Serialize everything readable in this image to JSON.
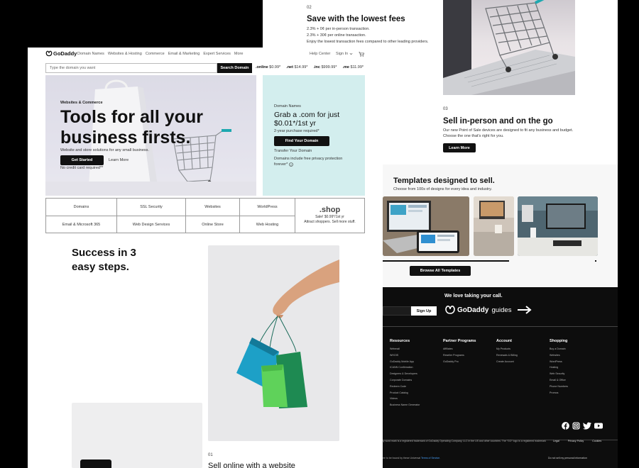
{
  "brand": {
    "name": "GoDaddy"
  },
  "nav": {
    "items": [
      "Domain Names",
      "Websites & Hosting",
      "Commerce",
      "Email & Marketing",
      "Expert Services",
      "More"
    ],
    "help": "Help Center",
    "sign_in": "Sign In"
  },
  "search": {
    "placeholder": "Type the domain you want",
    "button": "Search Domain",
    "tlds": [
      {
        "tld": ".online",
        "price": "$0.99*"
      },
      {
        "tld": ".net",
        "price": "$14.99*"
      },
      {
        "tld": ".inc",
        "price": "$999.99*"
      },
      {
        "tld": ".me",
        "price": "$11.99*"
      }
    ]
  },
  "hero": {
    "eyebrow": "Websites & Commerce",
    "title_line1": "Tools for all your",
    "title_line2": "business firsts.",
    "subtitle": "Website and store solutions for any small business.",
    "cta": "Get Started",
    "learn": "Learn More",
    "note": "No credit card required**"
  },
  "promo": {
    "eyebrow": "Domain Names",
    "title_line1": "Grab a .com for just",
    "title_line2": "$0.01*/1st yr",
    "note": "2-year purchase required*",
    "cta": "Find Your Domain",
    "transfer": "Transfer Your Domain",
    "privacy_line1": "Domains include free privacy protection",
    "privacy_line2": "forever*"
  },
  "categories": {
    "row1": [
      "Domains",
      "SSL Security",
      "Websites",
      "WorldPress"
    ],
    "row2": [
      "Email & Microsoft 365",
      "Web Design Services",
      "Online Store",
      "Web Hosting"
    ],
    "shop": {
      "tld": ".shop",
      "line1": "Sale! $0.99*/1st yr",
      "line2": "Attract shoppers. Sell more stuff."
    }
  },
  "steps_section": {
    "title_line1": "Success in 3",
    "title_line2": "easy steps.",
    "step1_num": "01",
    "step1_title": "Sell online with a website"
  },
  "step2": {
    "num": "02",
    "title": "Save with the lowest fees",
    "lines": [
      "2.3% + 0¢ per in-person transaction.",
      "2.3% + 30¢ per online transaction.",
      "Enjoy the lowest transaction fees compared to other leading providers."
    ]
  },
  "step3": {
    "num": "03",
    "title": "Sell in-person and on the go",
    "line1": "Our new Point of Sale devices are designed to fit any business and budget.",
    "line2": "Choose the one that's right for you.",
    "cta": "Learn More"
  },
  "templates": {
    "title": "Templates designed to sell.",
    "subtitle": "Choose from 100s of designs for every idea and industry.",
    "cta": "Browse All Templates"
  },
  "footer": {
    "call": "We love taking your call.",
    "signup": "Sign Up",
    "guides_brand": "GoDaddy",
    "guides": "guides",
    "columns": [
      {
        "title": "Resources",
        "links": [
          "Webmail",
          "WHOIS",
          "GoDaddy Mobile App",
          "ICANN Confirmation",
          "Designers & Developers",
          "Corporate Domains",
          "Redeem Code",
          "Product Catalog",
          "Videos",
          "Business Name Generator"
        ]
      },
      {
        "title": "Partner Programs",
        "links": [
          "Affiliates",
          "Reseller Programs",
          "GoDaddy Pro"
        ]
      },
      {
        "title": "Account",
        "links": [
          "My Products",
          "Renewals & Billing",
          "Create Account"
        ]
      },
      {
        "title": "Shopping",
        "links": [
          "Buy a Domain",
          "Websites",
          "WordPress",
          "Hosting",
          "Web Security",
          "Email & Office",
          "Phone Numbers",
          "Promos"
        ]
      }
    ],
    "legal_text": "ly word mark is a registered trademark of GoDaddy Operating Company, LLC in the US and other countries. The \"GO\" logo is a registered trademark",
    "legal_links": [
      "Legal",
      "Privacy Policy",
      "Cookies"
    ],
    "terms_prefix": "ee to be bound by these Universal",
    "terms_link": "Terms of Service.",
    "do_not_sell": "Do not sell my personal information"
  }
}
